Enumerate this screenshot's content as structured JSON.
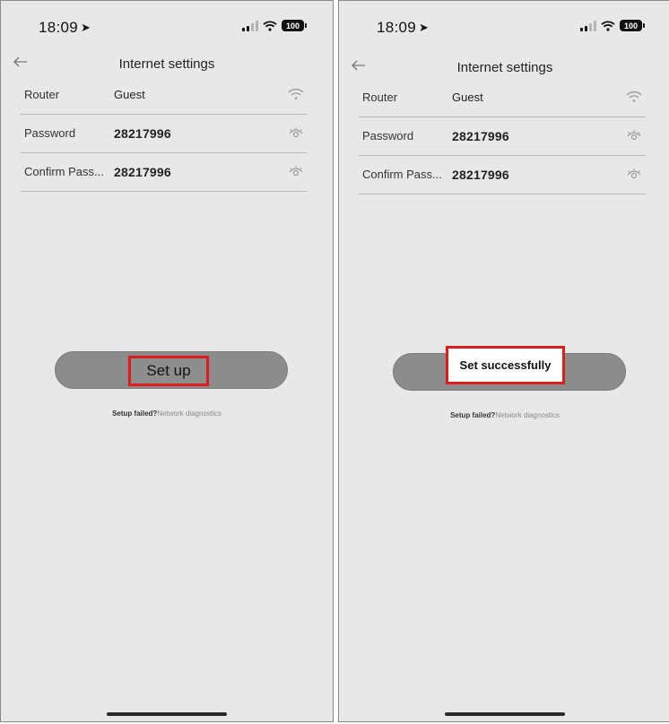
{
  "screens": [
    {
      "status": {
        "time": "18:09",
        "battery": "100"
      },
      "nav": {
        "title": "Internet settings",
        "back_icon": "back-arrow-icon"
      },
      "fields": [
        {
          "label": "Router",
          "value": "Guest",
          "icon": "wifi-icon"
        },
        {
          "label": "Password",
          "value": "28217996",
          "icon": "eye-icon"
        },
        {
          "label": "Confirm Pass...",
          "value": "28217996",
          "icon": "eye-icon"
        }
      ],
      "button": {
        "label": "Set up",
        "highlight_color": "#e01b1b"
      },
      "help": {
        "failed_text": "Setup failed?",
        "link_text": "Network diagnostics"
      }
    },
    {
      "status": {
        "time": "18:09",
        "battery": "100"
      },
      "nav": {
        "title": "Internet settings",
        "back_icon": "back-arrow-icon"
      },
      "fields": [
        {
          "label": "Router",
          "value": "Guest",
          "icon": "wifi-icon"
        },
        {
          "label": "Password",
          "value": "28217996",
          "icon": "eye-icon"
        },
        {
          "label": "Confirm Pass...",
          "value": "28217996",
          "icon": "eye-icon"
        }
      ],
      "toast": {
        "text": "Set successfully",
        "highlight_color": "#e01b1b"
      },
      "help": {
        "failed_text": "Setup failed?",
        "link_text": "Network diagnostics"
      }
    }
  ]
}
